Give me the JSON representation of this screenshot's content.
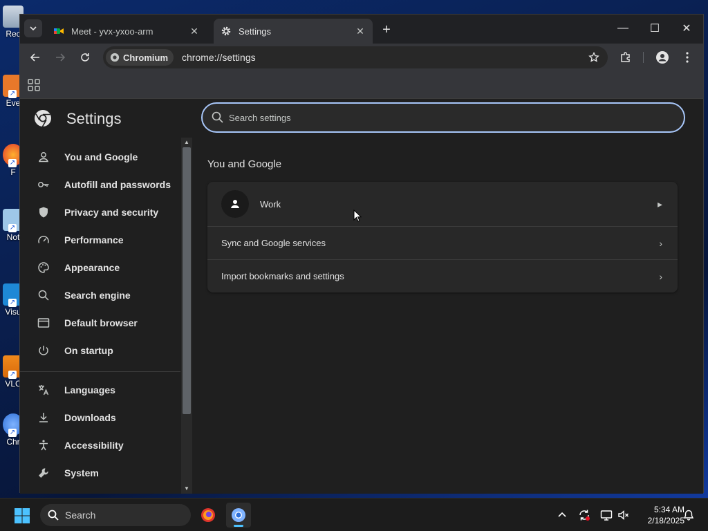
{
  "desktop": {
    "icons": [
      {
        "label": "Rec"
      },
      {
        "label": "Eve"
      },
      {
        "label": "F"
      },
      {
        "label": "Not"
      },
      {
        "label": "Visu"
      },
      {
        "label": "VLC"
      },
      {
        "label": "Chr"
      }
    ]
  },
  "browser": {
    "tabs": [
      {
        "title": "Meet - yvx-yxoo-arm",
        "active": false
      },
      {
        "title": "Settings",
        "active": true
      }
    ],
    "omnibox": {
      "chip_label": "Chromium",
      "url": "chrome://settings"
    }
  },
  "settings": {
    "title": "Settings",
    "search_placeholder": "Search settings",
    "nav": [
      {
        "label": "You and Google",
        "icon": "person-icon"
      },
      {
        "label": "Autofill and passwords",
        "icon": "key-icon"
      },
      {
        "label": "Privacy and security",
        "icon": "shield-icon"
      },
      {
        "label": "Performance",
        "icon": "speedometer-icon"
      },
      {
        "label": "Appearance",
        "icon": "palette-icon"
      },
      {
        "label": "Search engine",
        "icon": "search-icon"
      },
      {
        "label": "Default browser",
        "icon": "browser-window-icon"
      },
      {
        "label": "On startup",
        "icon": "power-icon"
      },
      {
        "label": "Languages",
        "icon": "translate-icon"
      },
      {
        "label": "Downloads",
        "icon": "download-icon"
      },
      {
        "label": "Accessibility",
        "icon": "accessibility-icon"
      },
      {
        "label": "System",
        "icon": "wrench-icon"
      }
    ],
    "section_title": "You and Google",
    "rows": {
      "profile_name": "Work",
      "sync": "Sync and Google services",
      "import": "Import bookmarks and settings"
    }
  },
  "taskbar": {
    "search_label": "Search",
    "time": "5:34 AM",
    "date": "2/18/2025"
  },
  "colors": {
    "accent": "#a8c7fa",
    "page_bg": "#1f1f1f",
    "card_bg": "#282828",
    "taskbar_indicator": "#4cc2ff"
  }
}
